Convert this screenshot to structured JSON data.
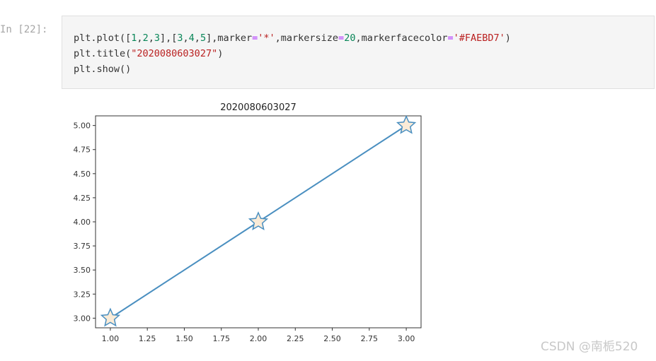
{
  "cell": {
    "prompt": "In [22]:",
    "lines": [
      "plt.plot([1,2,3],[3,4,5],marker='*',markersize=20,markerfacecolor='#FAEBD7')",
      "plt.title(\"2020080603027\")",
      "plt.show()"
    ]
  },
  "chart_data": {
    "type": "line",
    "title": "2020080603027",
    "x": [
      1,
      2,
      3
    ],
    "series": [
      {
        "values": [
          3,
          4,
          5
        ],
        "color": "#4a8fc0",
        "marker": "star",
        "markerfacecolor": "#FAEBD7"
      }
    ],
    "xticks": [
      "1.00",
      "1.25",
      "1.50",
      "1.75",
      "2.00",
      "2.25",
      "2.50",
      "2.75",
      "3.00"
    ],
    "yticks": [
      "3.00",
      "3.25",
      "3.50",
      "3.75",
      "4.00",
      "4.25",
      "4.50",
      "4.75",
      "5.00"
    ],
    "xlim": [
      0.9,
      3.1
    ],
    "ylim": [
      2.9,
      5.1
    ],
    "xlabel": "",
    "ylabel": "",
    "grid": false
  },
  "watermark": "CSDN @南栀520"
}
